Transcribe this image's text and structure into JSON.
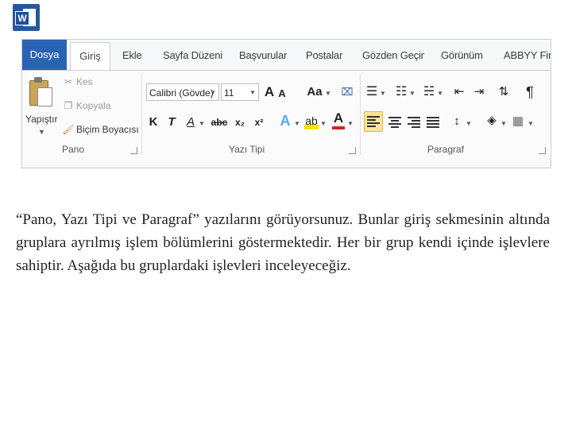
{
  "app": {
    "logo_letter": "W"
  },
  "ribbon": {
    "tabs": [
      "Dosya",
      "Giriş",
      "Ekle",
      "Sayfa Düzeni",
      "Başvurular",
      "Postalar",
      "Gözden Geçir",
      "Görünüm",
      "ABBYY Fine"
    ],
    "active_tab": "Giriş",
    "pano": {
      "group_label": "Pano",
      "paste_label": "Yapıştır",
      "kes_label": "Kes",
      "kopyala_label": "Kopyala",
      "bicim_boyacisi_label": "Biçim Boyacısı"
    },
    "yazi_tipi": {
      "group_label": "Yazı Tipi",
      "font_name": "Calibri (Gövde)",
      "font_size": "11",
      "bold": "K",
      "italic": "T",
      "underline": "A",
      "strikethrough": "abc",
      "subscript": "x₂",
      "superscript": "x²",
      "grow": "A",
      "shrink": "A",
      "change_case": "Aa"
    },
    "paragraf": {
      "group_label": "Paragraf",
      "pilcrow": "¶"
    },
    "colors": {
      "dosya_bg": "#2b63b4",
      "highlight": "#fde49a",
      "font_color": "#d42020"
    }
  },
  "body": {
    "paragraph": "“Pano, Yazı Tipi ve Paragraf” yazılarını görüyorsunuz. Bunlar giriş sekmesinin altında gruplara ayrılmış işlem bölümlerini göstermektedir. Her bir grup kendi içinde işlevlere sahiptir. Aşağıda bu gruplardaki işlevleri inceleyeceğiz."
  }
}
